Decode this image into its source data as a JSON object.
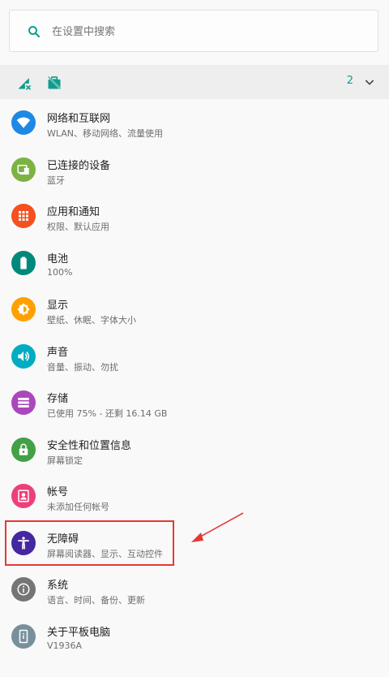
{
  "search": {
    "placeholder": "在设置中搜索",
    "icon": "search-icon"
  },
  "conditions": {
    "icons": [
      "no-sim-signal-icon",
      "work-profile-off-icon"
    ],
    "count": "2",
    "chevron": "chevron-down-icon"
  },
  "settings": {
    "items": [
      {
        "title": "网络和互联网",
        "subtitle": "WLAN、移动网络、流量使用",
        "icon": "wifi-icon",
        "color": "#1e88e5"
      },
      {
        "title": "已连接的设备",
        "subtitle": "蓝牙",
        "icon": "devices-icon",
        "color": "#7cb342"
      },
      {
        "title": "应用和通知",
        "subtitle": "权限、默认应用",
        "icon": "apps-icon",
        "color": "#f4511e"
      },
      {
        "title": "电池",
        "subtitle": "100%",
        "icon": "battery-icon",
        "color": "#00897b"
      },
      {
        "title": "显示",
        "subtitle": "壁纸、休眠、字体大小",
        "icon": "brightness-icon",
        "color": "#ffa000"
      },
      {
        "title": "声音",
        "subtitle": "音量、振动、勿扰",
        "icon": "volume-icon",
        "color": "#00acc1"
      },
      {
        "title": "存储",
        "subtitle": "已使用 75% - 还剩 16.14 GB",
        "icon": "storage-icon",
        "color": "#ab47bc"
      },
      {
        "title": "安全性和位置信息",
        "subtitle": "屏幕锁定",
        "icon": "lock-icon",
        "color": "#43a047"
      },
      {
        "title": "帐号",
        "subtitle": "未添加任何帐号",
        "icon": "account-icon",
        "color": "#ec407a"
      },
      {
        "title": "无障碍",
        "subtitle": "屏幕阅读器、显示、互动控件",
        "icon": "accessibility-icon",
        "color": "#4527a0"
      },
      {
        "title": "系统",
        "subtitle": "语言、时间、备份、更新",
        "icon": "info-icon",
        "color": "#757575"
      },
      {
        "title": "关于平板电脑",
        "subtitle": "V1936A",
        "icon": "tablet-icon",
        "color": "#78909c"
      }
    ]
  },
  "annotation": {
    "highlight_color": "#e53935",
    "highlighted_item": "无障碍"
  }
}
